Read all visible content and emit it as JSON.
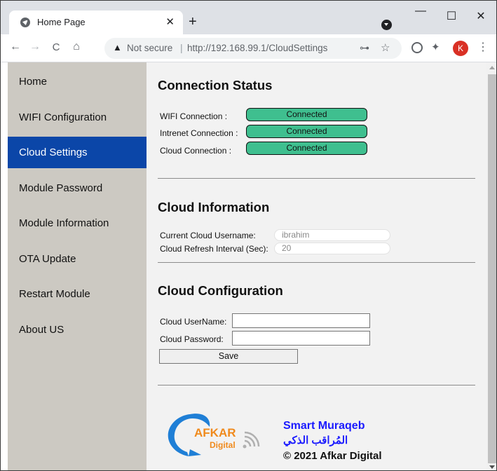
{
  "browser": {
    "tab_title": "Home Page",
    "tab_close": "✕",
    "new_tab": "+",
    "win_min": "—",
    "win_max": "☐",
    "win_close": "✕",
    "back": "←",
    "forward": "→",
    "reload": "C",
    "home": "⌂",
    "warning_glyph": "▲",
    "security_label": "Not secure",
    "separator": "|",
    "url": "http://192.168.99.1/CloudSettings",
    "key_glyph": "⊶",
    "star_glyph": "☆",
    "puzzle_glyph": "✦",
    "avatar_initial": "K",
    "menu_glyph": "⋮"
  },
  "sidebar": {
    "items": [
      {
        "label": "Home"
      },
      {
        "label": "WIFI Configuration"
      },
      {
        "label": "Cloud Settings",
        "active": true
      },
      {
        "label": "Module Password"
      },
      {
        "label": "Module Information"
      },
      {
        "label": "OTA Update"
      },
      {
        "label": "Restart Module"
      },
      {
        "label": "About US"
      }
    ]
  },
  "connection_status": {
    "heading": "Connection Status",
    "rows": [
      {
        "label": "WIFI Connection :",
        "value": "Connected"
      },
      {
        "label": "Intrenet Connection :",
        "value": "Connected"
      },
      {
        "label": "Cloud Connection :",
        "value": "Connected"
      }
    ]
  },
  "cloud_information": {
    "heading": "Cloud Information",
    "username_label": "Current Cloud Username:",
    "username_value": "ibrahim",
    "refresh_label": "Cloud Refresh Interval (Sec):",
    "refresh_value": "20"
  },
  "cloud_configuration": {
    "heading": "Cloud Configuration",
    "username_label": "Cloud UserName:",
    "username_value": "",
    "password_label": "Cloud Password:",
    "password_value": "",
    "save_label": "Save"
  },
  "footer": {
    "logo_word": "AFKAR",
    "logo_sub": "Digital",
    "product_name": "Smart Muraqeb",
    "product_name_arabic": "المُراقب الذكي",
    "copyright": "© 2021 Afkar Digital"
  },
  "colors": {
    "sidebar_bg": "#ccc9c2",
    "active_item": "#0b46a8",
    "status_green": "#3fbf8f",
    "brand_blue": "#1a1aff",
    "logo_blue": "#1f7fd6",
    "logo_orange": "#f08a1c"
  }
}
